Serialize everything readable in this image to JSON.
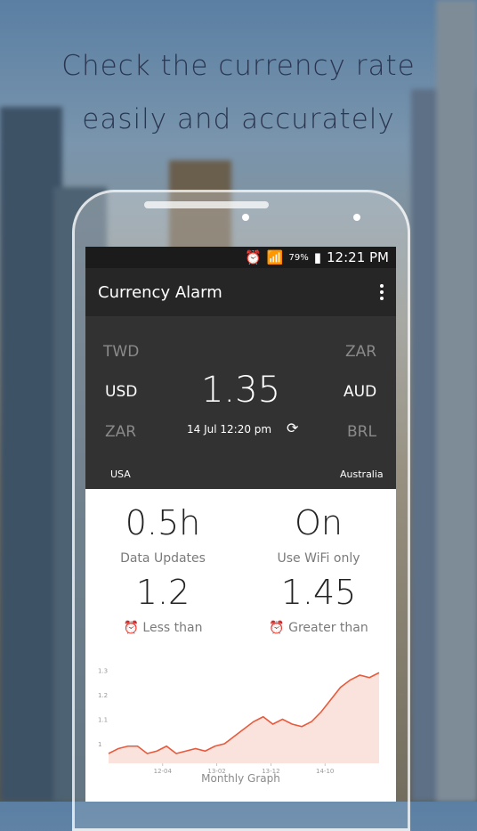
{
  "promo": {
    "line1": "Check the currency rate",
    "line2": "easily and accurately"
  },
  "status_bar": {
    "battery": "79%",
    "time": "12:21 PM"
  },
  "app_bar": {
    "title": "Currency Alarm"
  },
  "rates": {
    "left_top": "TWD",
    "left_selected": "USD",
    "left_bottom": "ZAR",
    "right_top": "ZAR",
    "right_selected": "AUD",
    "right_bottom": "BRL",
    "rate": "1.35",
    "timestamp": "14 Jul 12:20 pm",
    "left_country": "USA",
    "right_country": "Australia"
  },
  "stats": {
    "update_value": "0.5h",
    "update_label": "Data Updates",
    "wifi_value": "On",
    "wifi_label": "Use WiFi only",
    "low_value": "1.2",
    "low_label": "Less than",
    "high_value": "1.45",
    "high_label": "Greater than"
  },
  "chart_data": {
    "type": "area",
    "title": "Monthly Graph",
    "ytick_labels": [
      "1.3",
      "1.2",
      "1.1",
      "1"
    ],
    "xtick_labels": [
      "12-04",
      "13-02",
      "13-12",
      "14-10"
    ],
    "series_color": "#e85a3c",
    "fill_color": "#fbe3dd",
    "values": [
      0.96,
      0.98,
      0.99,
      0.99,
      0.96,
      0.97,
      0.99,
      0.96,
      0.97,
      0.98,
      0.97,
      0.99,
      1.0,
      1.03,
      1.06,
      1.09,
      1.11,
      1.08,
      1.1,
      1.08,
      1.07,
      1.09,
      1.13,
      1.18,
      1.23,
      1.26,
      1.28,
      1.27,
      1.29
    ]
  }
}
